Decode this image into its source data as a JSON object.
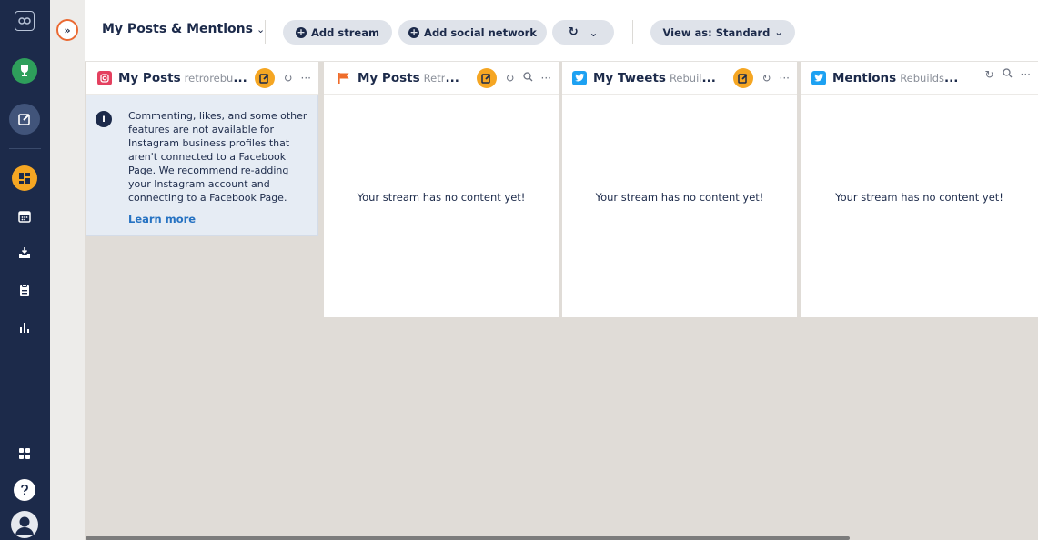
{
  "header": {
    "tab_title": "My Posts & Mentions",
    "add_stream": "Add stream",
    "add_social": "Add social network",
    "refresh_chevron": "⌄",
    "view_as": "View as: Standard"
  },
  "streams": [
    {
      "network": "instagram",
      "title": "My Posts",
      "subtitle": "retrorebu",
      "empty": ""
    },
    {
      "network": "flag",
      "title": "My Posts",
      "subtitle": "Retr",
      "empty": "Your stream has no content yet!"
    },
    {
      "network": "twitter",
      "title": "My Tweets",
      "subtitle": "Rebuil",
      "empty": "Your stream has no content yet!"
    },
    {
      "network": "twitter",
      "title": "Mentions",
      "subtitle": "Rebuilds",
      "empty": "Your stream has no content yet!"
    }
  ],
  "notice": {
    "text": "Commenting, likes, and some other features are not available for Instagram business profiles that aren't connected to a Facebook Page. We recommend re-adding your Instagram account and connecting to a Facebook Page.",
    "link": "Learn more"
  },
  "ellipsis": "...",
  "colors": {
    "nav_bg": "#1c2a4a",
    "accent_orange": "#f5a623",
    "instagram": "#e4405f",
    "twitter": "#1da1f2",
    "board_bg": "#e0dcd7"
  }
}
